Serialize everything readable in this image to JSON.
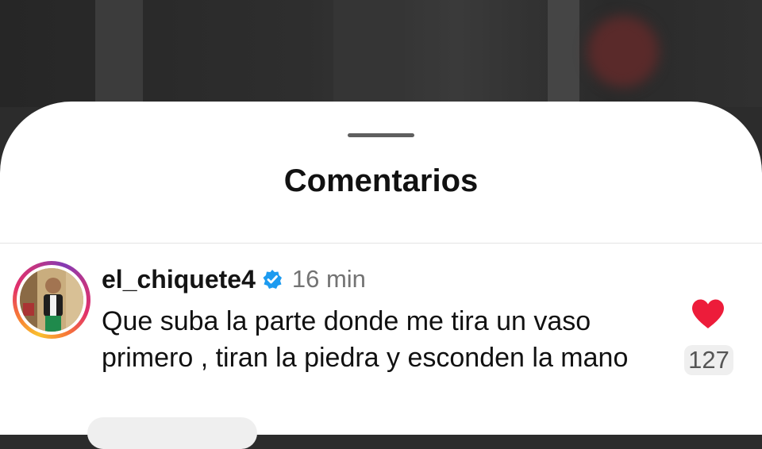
{
  "sheet": {
    "title": "Comentarios"
  },
  "comment": {
    "username": "el_chiquete4",
    "verified": true,
    "time": "16 min",
    "text": "Que suba la parte donde me tira un vaso primero , tiran la piedra y esconden la mano",
    "like_count": "127",
    "liked": true
  },
  "colors": {
    "heart": "#ed1c3a",
    "verified_badge": "#1d9bf0",
    "timestamp": "#737373"
  },
  "icons": {
    "like": "heart-icon",
    "verified": "verified-badge-icon"
  }
}
